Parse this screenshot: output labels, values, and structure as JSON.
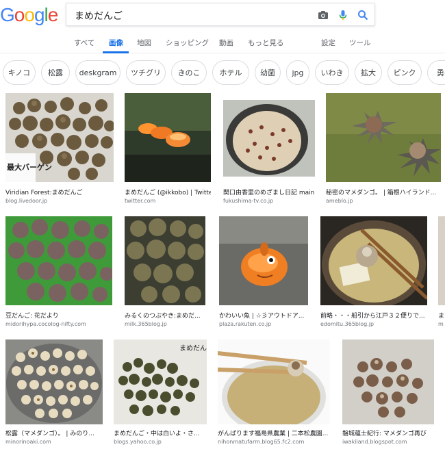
{
  "logo": {
    "letters": [
      "G",
      "o",
      "o",
      "g",
      "l",
      "e"
    ],
    "colors": [
      "#4285f4",
      "#ea4335",
      "#fbbc05",
      "#4285f4",
      "#34a853",
      "#ea4335"
    ]
  },
  "search": {
    "query": "まめだんご"
  },
  "tabs": {
    "all": "すべて",
    "images": "画像",
    "maps": "地図",
    "shopping": "ショッピング",
    "videos": "動画",
    "more": "もっと見る",
    "settings": "設定",
    "tools": "ツール"
  },
  "chips": [
    "キノコ",
    "松露",
    "deskgram",
    "ツチグリ",
    "きのこ",
    "ホテル",
    "幼菌",
    "jpg",
    "いわき",
    "拡大",
    "ピンク",
    "勇平"
  ],
  "results": [
    {
      "caption": "Viridian Forest:まめだんご",
      "source": "blog.livedoor.jp",
      "overlay": "最大バーゲン"
    },
    {
      "caption": "まめだんご (@ikkobo) | Twitter",
      "source": "twitter.com"
    },
    {
      "caption": "関口由香里のめざまし日記 main",
      "source": "fukushima-tv.co.jp"
    },
    {
      "caption": "秘密のマメダンゴ。 | 箱根ハイランド...",
      "source": "ameblo.jp"
    },
    {
      "caption": "豆だんご: 花だより",
      "source": "midorihypa.cocolog-nifty.com"
    },
    {
      "caption": "みるくのつぶやき:まめだ...",
      "source": "milk.365blog.jp"
    },
    {
      "caption": "かわいい魚 | ☆彡アウトドア...",
      "source": "plaza.rakuten.co.jp"
    },
    {
      "caption": "前略・・・船引から江戸３２便りで...",
      "source": "edomitu.365blog.jp"
    },
    {
      "caption": "ま",
      "source": "m"
    },
    {
      "caption": "松露（マメダンゴ）。 | みのり...",
      "source": "minorinoaki.com"
    },
    {
      "caption": "まめだんご・中は白いよ・さ...",
      "source": "blogs.yahoo.co.jp",
      "overlay": "まめだん"
    },
    {
      "caption": "がんばります福島県農業 | 二本松農園...",
      "source": "nihonmatufarm.blog65.fc2.com"
    },
    {
      "caption": "磐城蘊士紀行: マメダンゴ再び",
      "source": "iwakiland.blogspot.com"
    }
  ]
}
